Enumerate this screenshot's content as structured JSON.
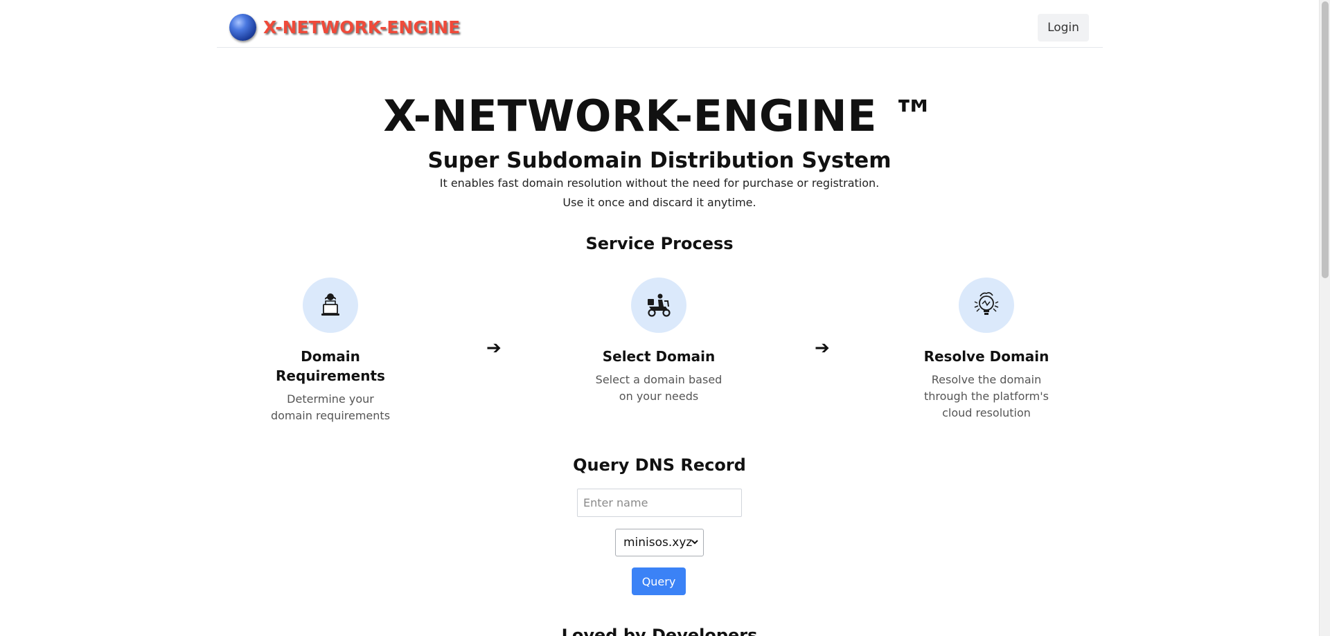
{
  "header": {
    "brand": "X-NETWORK-ENGINE",
    "login_label": "Login"
  },
  "hero": {
    "title": "X-NETWORK-ENGINE ™",
    "subtitle": "Super Subdomain Distribution System",
    "description_line1": "It enables fast domain resolution without the need for purchase or registration.",
    "description_line2": "Use it once and discard it anytime."
  },
  "service_process": {
    "title": "Service Process",
    "arrow": "➔",
    "steps": [
      {
        "icon": "person-laptop-icon",
        "title": "Domain Requirements",
        "description": "Determine your domain requirements"
      },
      {
        "icon": "scooter-delivery-icon",
        "title": "Select Domain",
        "description": "Select a domain based on your needs"
      },
      {
        "icon": "lightbulb-cloud-icon",
        "title": "Resolve Domain",
        "description": "Resolve the domain through the platform's cloud resolution"
      }
    ]
  },
  "query": {
    "title": "Query DNS Record",
    "name_placeholder": "Enter name",
    "name_value": "",
    "domain_selected": "minisos.xyz",
    "button_label": "Query"
  },
  "next_section": {
    "title": "Loved by Developers"
  },
  "colors": {
    "brand_red": "#ef4a3a",
    "accent_blue": "#3b82f6",
    "step_circle": "#dbe9fb"
  }
}
